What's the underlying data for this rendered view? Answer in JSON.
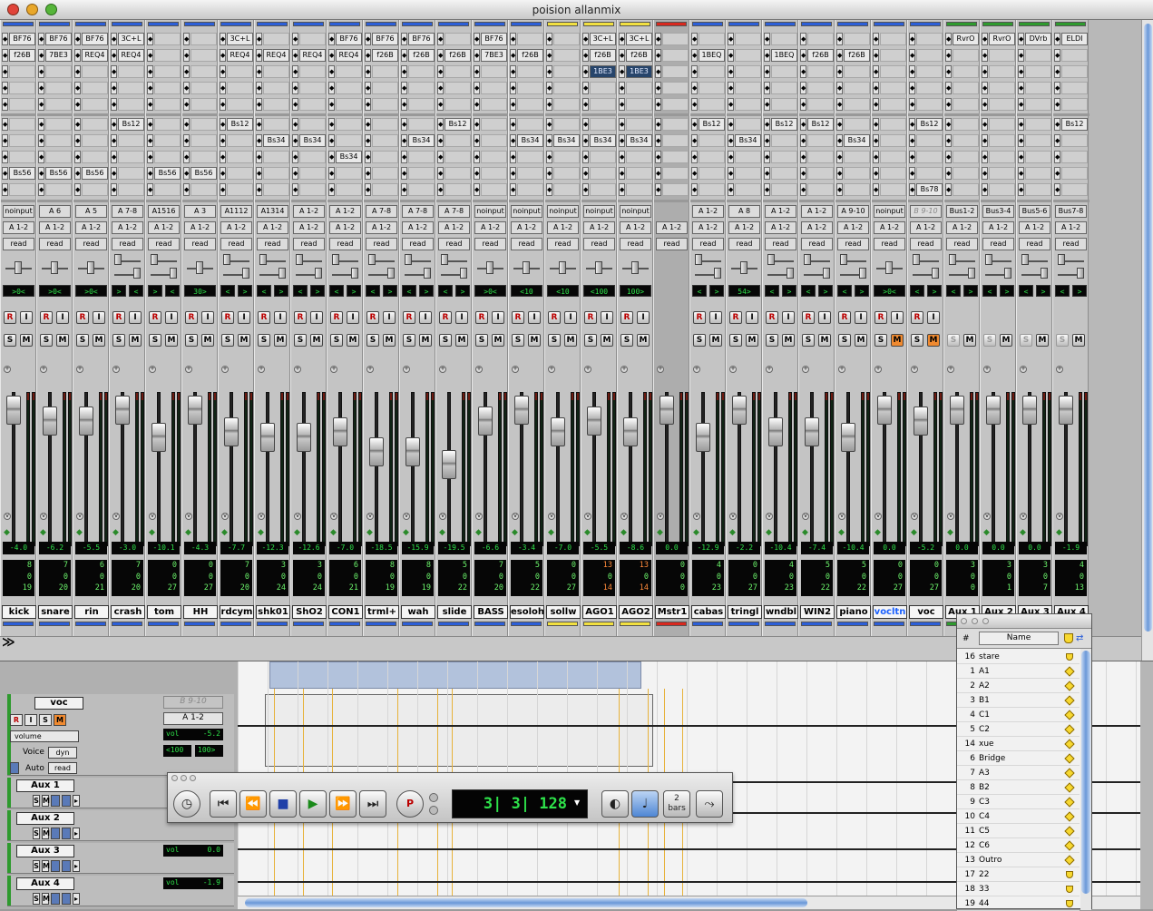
{
  "window": {
    "title": "poision allanmix"
  },
  "strips": [
    {
      "color": "#2c5fd8",
      "ins": [
        "BF76",
        "f26B",
        "",
        "",
        "",
        ""
      ],
      "sends": [
        "",
        "",
        "",
        "Bs56",
        ""
      ],
      "input": "noinput",
      "output": "A 1-2",
      "auto": "read",
      "pan": ">0<",
      "pantype": "mono",
      "vol": "-4.0",
      "n": [
        "8",
        "0",
        "19"
      ],
      "name": "kick",
      "fader": 0
    },
    {
      "color": "#2c5fd8",
      "ins": [
        "BF76",
        "7BE3",
        "",
        "",
        "",
        ""
      ],
      "sends": [
        "",
        "",
        "",
        "Bs56",
        ""
      ],
      "input": "A 6",
      "output": "A 1-2",
      "auto": "read",
      "pan": ">0<",
      "pantype": "mono",
      "vol": "-6.2",
      "n": [
        "7",
        "0",
        "20"
      ],
      "name": "snare",
      "fader": 1
    },
    {
      "color": "#2c5fd8",
      "ins": [
        "BF76",
        "REQ4",
        "",
        "",
        "",
        ""
      ],
      "sends": [
        "",
        "",
        "",
        "Bs56",
        ""
      ],
      "input": "A 5",
      "output": "A 1-2",
      "auto": "read",
      "pan": ">0<",
      "pantype": "mono",
      "vol": "-5.5",
      "n": [
        "6",
        "0",
        "21"
      ],
      "name": "rin",
      "fader": 1
    },
    {
      "color": "#2c5fd8",
      "ins": [
        "3C+L",
        "REQ4",
        "",
        "",
        "",
        ""
      ],
      "sends": [
        "Bs12",
        "",
        "",
        "",
        ""
      ],
      "input": "A 7-8",
      "output": "A 1-2",
      "auto": "read",
      "pan": ">|<",
      "pantype": "stereo",
      "vol": "-3.0",
      "n": [
        "7",
        "0",
        "20"
      ],
      "name": "crash",
      "fader": 0
    },
    {
      "color": "#2c5fd8",
      "ins": [
        "",
        "",
        "",
        "",
        "",
        ""
      ],
      "sends": [
        "",
        "",
        "",
        "Bs56",
        ""
      ],
      "input": "A1516",
      "output": "A 1-2",
      "auto": "read",
      "pan": ">|<",
      "pantype": "stereo",
      "vol": "-10.1",
      "n": [
        "0",
        "0",
        "27"
      ],
      "name": "tom",
      "fader": 3
    },
    {
      "color": "#2c5fd8",
      "ins": [
        "",
        "",
        "",
        "",
        "",
        ""
      ],
      "sends": [
        "",
        "",
        "",
        "Bs56",
        ""
      ],
      "input": "A 3",
      "output": "A 1-2",
      "auto": "read",
      "pan": "30>",
      "pantype": "mono",
      "vol": "-4.3",
      "n": [
        "0",
        "0",
        "27"
      ],
      "name": "HH",
      "fader": 0
    },
    {
      "color": "#2c5fd8",
      "ins": [
        "3C+L",
        "REQ4",
        "",
        "",
        "",
        ""
      ],
      "sends": [
        "Bs12",
        "",
        "",
        "",
        ""
      ],
      "input": "A1112",
      "output": "A 1-2",
      "auto": "read",
      "pan": "<|>",
      "pantype": "stereo",
      "vol": "-7.7",
      "n": [
        "7",
        "0",
        "20"
      ],
      "name": "rdcym",
      "fader": 2
    },
    {
      "color": "#2c5fd8",
      "ins": [
        "",
        "REQ4",
        "",
        "",
        "",
        ""
      ],
      "sends": [
        "",
        "Bs34",
        "",
        "",
        ""
      ],
      "input": "A1314",
      "output": "A 1-2",
      "auto": "read",
      "pan": "<|>",
      "pantype": "stereo",
      "vol": "-12.3",
      "n": [
        "3",
        "0",
        "24"
      ],
      "name": "shk01",
      "fader": 3
    },
    {
      "color": "#2c5fd8",
      "ins": [
        "",
        "REQ4",
        "",
        "",
        "",
        ""
      ],
      "sends": [
        "",
        "Bs34",
        "",
        "",
        ""
      ],
      "input": "A 1-2",
      "output": "A 1-2",
      "auto": "read",
      "pan": "<|>",
      "pantype": "stereo",
      "vol": "-12.6",
      "n": [
        "3",
        "0",
        "24"
      ],
      "name": "ShO2",
      "fader": 3
    },
    {
      "color": "#2c5fd8",
      "ins": [
        "BF76",
        "REQ4",
        "",
        "",
        "",
        ""
      ],
      "sends": [
        "",
        "",
        "Bs34",
        "",
        ""
      ],
      "input": "A 1-2",
      "output": "A 1-2",
      "auto": "read",
      "pan": "<|>",
      "pantype": "stereo",
      "vol": "-7.0",
      "n": [
        "6",
        "0",
        "21"
      ],
      "name": "CON1",
      "fader": 2
    },
    {
      "color": "#2c5fd8",
      "ins": [
        "BF76",
        "f26B",
        "",
        "",
        "",
        ""
      ],
      "sends": [
        "",
        "",
        "",
        "",
        ""
      ],
      "input": "A 7-8",
      "output": "A 1-2",
      "auto": "read",
      "pan": "<|>",
      "pantype": "stereo",
      "vol": "-18.5",
      "n": [
        "8",
        "0",
        "19"
      ],
      "name": "trml+",
      "fader": 4
    },
    {
      "color": "#2c5fd8",
      "ins": [
        "BF76",
        "f26B",
        "",
        "",
        "",
        ""
      ],
      "sends": [
        "",
        "Bs34",
        "",
        "",
        ""
      ],
      "input": "A 7-8",
      "output": "A 1-2",
      "auto": "read",
      "pan": "<|>",
      "pantype": "stereo",
      "vol": "-15.9",
      "n": [
        "8",
        "0",
        "19"
      ],
      "name": "wah",
      "fader": 4
    },
    {
      "color": "#2c5fd8",
      "ins": [
        "",
        "f26B",
        "",
        "",
        "",
        ""
      ],
      "sends": [
        "Bs12",
        "",
        "",
        "",
        ""
      ],
      "input": "A 7-8",
      "output": "A 1-2",
      "auto": "read",
      "pan": "<|>",
      "pantype": "stereo",
      "vol": "-19.5",
      "n": [
        "5",
        "0",
        "22"
      ],
      "name": "slide",
      "fader": 5
    },
    {
      "color": "#2c5fd8",
      "ins": [
        "BF76",
        "7BE3",
        "",
        "",
        "",
        ""
      ],
      "sends": [
        "",
        "",
        "",
        "",
        ""
      ],
      "input": "noinput",
      "output": "A 1-2",
      "auto": "read",
      "pan": ">0<",
      "pantype": "mono",
      "vol": "-6.6",
      "n": [
        "7",
        "0",
        "20"
      ],
      "name": "BASS",
      "fader": 1
    },
    {
      "color": "#2c5fd8",
      "ins": [
        "",
        "f26B",
        "",
        "",
        "",
        ""
      ],
      "sends": [
        "",
        "Bs34",
        "",
        "",
        ""
      ],
      "input": "noinput",
      "output": "A 1-2",
      "auto": "read",
      "pan": "<10",
      "pantype": "mono",
      "vol": "-3.4",
      "n": [
        "5",
        "0",
        "22"
      ],
      "name": "esoloh",
      "fader": 0
    },
    {
      "color": "#f2e040",
      "ins": [
        "",
        "",
        "",
        "",
        "",
        ""
      ],
      "sends": [
        "",
        "Bs34",
        "",
        "",
        ""
      ],
      "input": "noinput",
      "output": "A 1-2",
      "auto": "read",
      "pan": "<10",
      "pantype": "mono",
      "vol": "-7.0",
      "n": [
        "0",
        "0",
        "27"
      ],
      "name": "sollw",
      "fader": 2
    },
    {
      "color": "#f2e040",
      "ins": [
        "3C+L",
        "f26B",
        "1BE3",
        "",
        "",
        ""
      ],
      "sends": [
        "",
        "Bs34",
        "",
        "",
        ""
      ],
      "input": "noinput",
      "output": "A 1-2",
      "auto": "read",
      "pan": "<100",
      "pantype": "mono",
      "vol": "-5.5",
      "n": [
        "13",
        "0",
        "14"
      ],
      "name": "AGO1",
      "fader": 1,
      "red": true
    },
    {
      "color": "#f2e040",
      "ins": [
        "3C+L",
        "f26B",
        "1BE3",
        "",
        "",
        ""
      ],
      "sends": [
        "",
        "Bs34",
        "",
        "",
        ""
      ],
      "input": "noinput",
      "output": "A 1-2",
      "auto": "read",
      "pan": "100>",
      "pantype": "mono",
      "vol": "-8.6",
      "n": [
        "13",
        "0",
        "14"
      ],
      "name": "AGO2",
      "fader": 2,
      "red": true
    },
    {
      "color": "#d8281e",
      "ins": [
        "",
        "",
        "",
        "",
        "",
        ""
      ],
      "sends": [
        "",
        "",
        "",
        "",
        ""
      ],
      "input": "",
      "output": "A 1-2",
      "auto": "read",
      "pan": "",
      "pantype": "none",
      "vol": "0.0",
      "n": [
        "0",
        "0",
        "0"
      ],
      "name": "Mstr1",
      "fader": 0,
      "dim": true
    },
    {
      "color": "#2c5fd8",
      "ins": [
        "",
        "1BEQ",
        "",
        "",
        "",
        ""
      ],
      "sends": [
        "Bs12",
        "",
        "",
        "",
        ""
      ],
      "input": "A 1-2",
      "output": "A 1-2",
      "auto": "read",
      "pan": "<|>",
      "pantype": "stereo",
      "vol": "-12.9",
      "n": [
        "4",
        "0",
        "23"
      ],
      "name": "cabas",
      "fader": 3
    },
    {
      "color": "#2c5fd8",
      "ins": [
        "",
        "",
        "",
        "",
        "",
        ""
      ],
      "sends": [
        "",
        "Bs34",
        "",
        "",
        ""
      ],
      "input": "A 8",
      "output": "A 1-2",
      "auto": "read",
      "pan": "54>",
      "pantype": "mono",
      "vol": "-2.2",
      "n": [
        "0",
        "0",
        "27"
      ],
      "name": "tringl",
      "fader": 0
    },
    {
      "color": "#2c5fd8",
      "ins": [
        "",
        "1BEQ",
        "",
        "",
        "",
        ""
      ],
      "sends": [
        "Bs12",
        "",
        "",
        "",
        ""
      ],
      "input": "A 1-2",
      "output": "A 1-2",
      "auto": "read",
      "pan": "<|>",
      "pantype": "stereo",
      "vol": "-10.4",
      "n": [
        "4",
        "0",
        "23"
      ],
      "name": "wndbl",
      "fader": 2
    },
    {
      "color": "#2c5fd8",
      "ins": [
        "",
        "f26B",
        "",
        "",
        "",
        ""
      ],
      "sends": [
        "Bs12",
        "",
        "",
        "",
        ""
      ],
      "input": "A 1-2",
      "output": "A 1-2",
      "auto": "read",
      "pan": "<|>",
      "pantype": "stereo",
      "vol": "-7.4",
      "n": [
        "5",
        "0",
        "22"
      ],
      "name": "WIN2",
      "fader": 2
    },
    {
      "color": "#2c5fd8",
      "ins": [
        "",
        "f26B",
        "",
        "",
        "",
        ""
      ],
      "sends": [
        "",
        "Bs34",
        "",
        "",
        ""
      ],
      "input": "A 9-10",
      "output": "A 1-2",
      "auto": "read",
      "pan": "<|>",
      "pantype": "stereo",
      "vol": "-10.4",
      "n": [
        "5",
        "0",
        "22"
      ],
      "name": "piano",
      "fader": 3
    },
    {
      "color": "#2c5fd8",
      "ins": [
        "",
        "",
        "",
        "",
        "",
        ""
      ],
      "sends": [
        "",
        "",
        "",
        "",
        ""
      ],
      "input": "noinput",
      "output": "A 1-2",
      "auto": "read",
      "pan": ">0<",
      "pantype": "mono",
      "vol": "0.0",
      "n": [
        "0",
        "0",
        "27"
      ],
      "name": "vocltn",
      "fader": 0,
      "hiname": true,
      "mon": true
    },
    {
      "color": "#2c5fd8",
      "ins": [
        "",
        "",
        "",
        "",
        "",
        ""
      ],
      "sends": [
        "Bs12",
        "",
        "",
        "",
        "Bs78"
      ],
      "input": "B 9-10",
      "output": "A 1-2",
      "auto": "read",
      "pan": "<|>",
      "pantype": "stereo",
      "vol": "-5.2",
      "n": [
        "0",
        "0",
        "27"
      ],
      "name": "voc",
      "fader": 1,
      "greyin": true,
      "mon": true
    },
    {
      "color": "#2e9a2e",
      "ins": [
        "RvrO",
        "",
        "",
        "",
        "",
        ""
      ],
      "sends": [
        "",
        "",
        "",
        "",
        ""
      ],
      "input": "Bus1-2",
      "output": "A 1-2",
      "auto": "read",
      "pan": "<|>",
      "pantype": "stereo",
      "vol": "0.0",
      "n": [
        "3",
        "0",
        "0"
      ],
      "name": "Aux 1",
      "fader": 0,
      "aux": true
    },
    {
      "color": "#2e9a2e",
      "ins": [
        "RvrO",
        "",
        "",
        "",
        "",
        ""
      ],
      "sends": [
        "",
        "",
        "",
        "",
        ""
      ],
      "input": "Bus3-4",
      "output": "A 1-2",
      "auto": "read",
      "pan": "<|>",
      "pantype": "stereo",
      "vol": "0.0",
      "n": [
        "3",
        "0",
        "1"
      ],
      "name": "Aux 2",
      "fader": 0,
      "aux": true
    },
    {
      "color": "#2e9a2e",
      "ins": [
        "DVrb",
        "",
        "",
        "",
        "",
        ""
      ],
      "sends": [
        "",
        "",
        "",
        "",
        ""
      ],
      "input": "Bus5-6",
      "output": "A 1-2",
      "auto": "read",
      "pan": "<|>",
      "pantype": "stereo",
      "vol": "0.0",
      "n": [
        "3",
        "0",
        "7"
      ],
      "name": "Aux 3",
      "fader": 0,
      "aux": true
    },
    {
      "color": "#2e9a2e",
      "ins": [
        "ELDI",
        "",
        "",
        "",
        "",
        ""
      ],
      "sends": [
        "Bs12",
        "",
        "",
        "",
        ""
      ],
      "input": "Bus7-8",
      "output": "A 1-2",
      "auto": "read",
      "pan": "<|>",
      "pantype": "stereo",
      "vol": "-1.9",
      "n": [
        "4",
        "0",
        "13"
      ],
      "name": "Aux 4",
      "fader": 0,
      "aux": true
    }
  ],
  "edit": {
    "voc": {
      "name": "voc",
      "view": "volume",
      "voice": "Voice",
      "voice_val": "dyn",
      "auto_label": "Auto",
      "auto": "read",
      "input": "B 9-10",
      "output": "A 1-2",
      "vol_label": "vol",
      "vol": "-5.2",
      "pan_l": "<100",
      "pan_r": "100>"
    },
    "aux": [
      {
        "name": "Aux 1"
      },
      {
        "name": "Aux 2"
      },
      {
        "name": "Aux 3",
        "vol_label": "vol",
        "vol": "0.0"
      },
      {
        "name": "Aux 4",
        "vol_label": "vol",
        "vol": "-1.9"
      }
    ]
  },
  "transport": {
    "counter": "3| 3| 128",
    "bars_num": "2",
    "bars_label": "bars"
  },
  "markers": {
    "col_num": "#",
    "col_name": "Name",
    "rows": [
      {
        "n": "16",
        "name": "stare",
        "shield": true
      },
      {
        "n": "1",
        "name": "A1"
      },
      {
        "n": "2",
        "name": "A2"
      },
      {
        "n": "3",
        "name": "B1"
      },
      {
        "n": "4",
        "name": "C1"
      },
      {
        "n": "5",
        "name": "C2"
      },
      {
        "n": "14",
        "name": "xue"
      },
      {
        "n": "6",
        "name": "Bridge"
      },
      {
        "n": "7",
        "name": "A3"
      },
      {
        "n": "8",
        "name": "B2"
      },
      {
        "n": "9",
        "name": "C3"
      },
      {
        "n": "10",
        "name": "C4"
      },
      {
        "n": "11",
        "name": "C5"
      },
      {
        "n": "12",
        "name": "C6"
      },
      {
        "n": "13",
        "name": "Outro"
      },
      {
        "n": "17",
        "name": "22",
        "shield": true
      },
      {
        "n": "18",
        "name": "33",
        "shield": true
      },
      {
        "n": "19",
        "name": "44",
        "shield": true
      }
    ]
  },
  "labels": {
    "R": "R",
    "I": "I",
    "S": "S",
    "M": "M",
    "expand": "≫"
  }
}
